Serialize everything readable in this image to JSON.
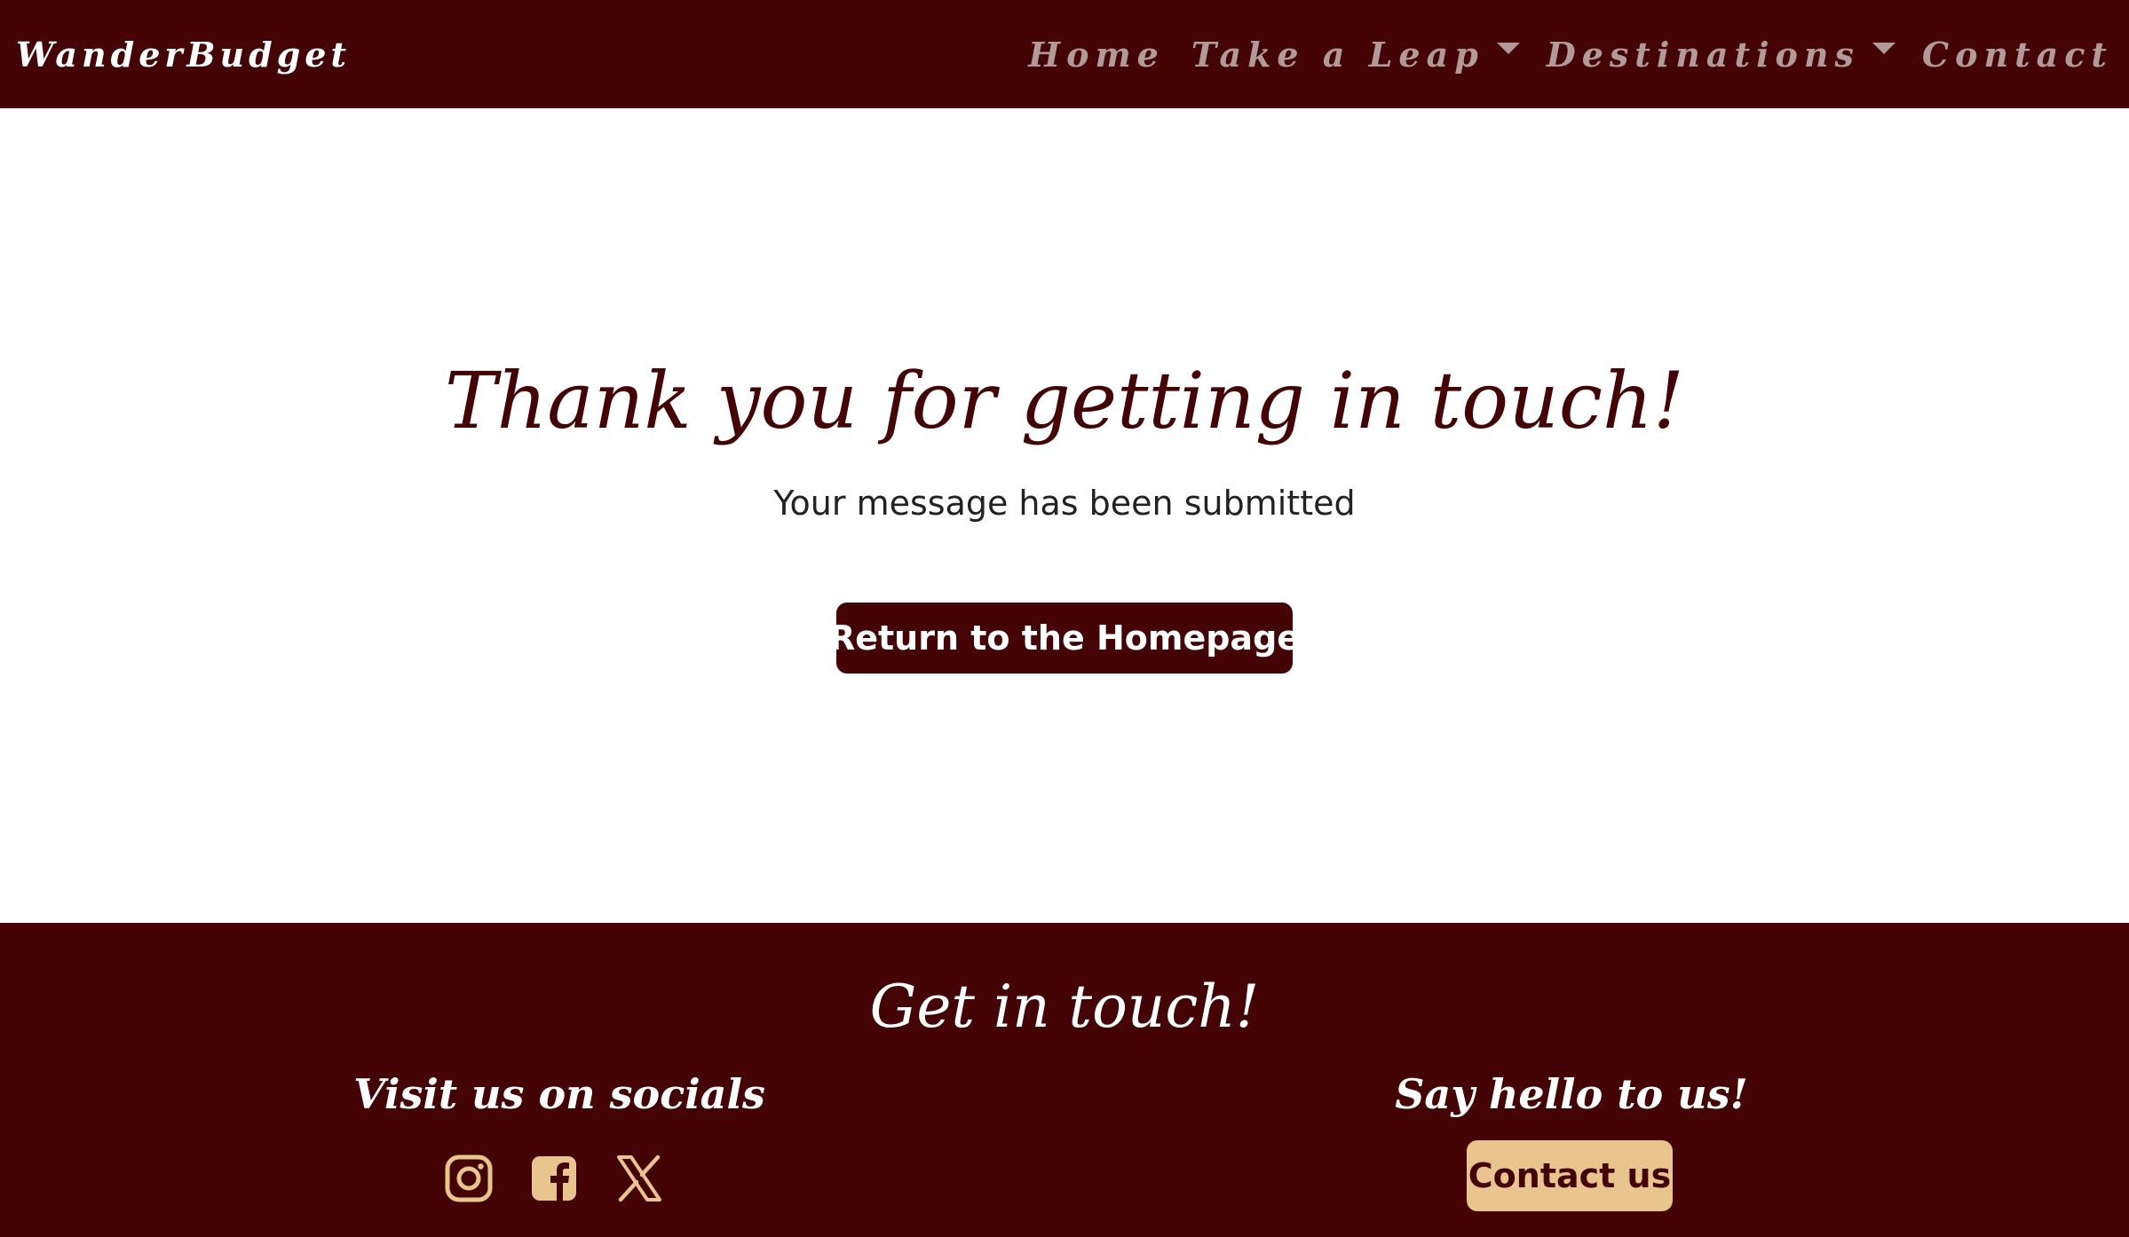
{
  "navbar": {
    "brand": "WanderBudget",
    "links": [
      {
        "label": "Home",
        "dropdown": false
      },
      {
        "label": "Take a Leap",
        "dropdown": true
      },
      {
        "label": "Destinations",
        "dropdown": true
      },
      {
        "label": "Contact",
        "dropdown": false
      }
    ]
  },
  "main": {
    "title": "Thank you for getting in touch!",
    "subtitle": "Your message has been submitted",
    "home_button": "Return to the Homepage"
  },
  "footer": {
    "title": "Get in touch!",
    "socials_title": "Visit us on socials",
    "socials": [
      {
        "icon": "instagram-icon"
      },
      {
        "icon": "facebook-icon"
      },
      {
        "icon": "x-icon"
      }
    ],
    "hello_title": "Say hello to us!",
    "contact_button": "Contact us"
  },
  "colors": {
    "brand_dark": "#440305",
    "accent_tan": "#e8c48f",
    "nav_muted": "#b39a9a"
  }
}
